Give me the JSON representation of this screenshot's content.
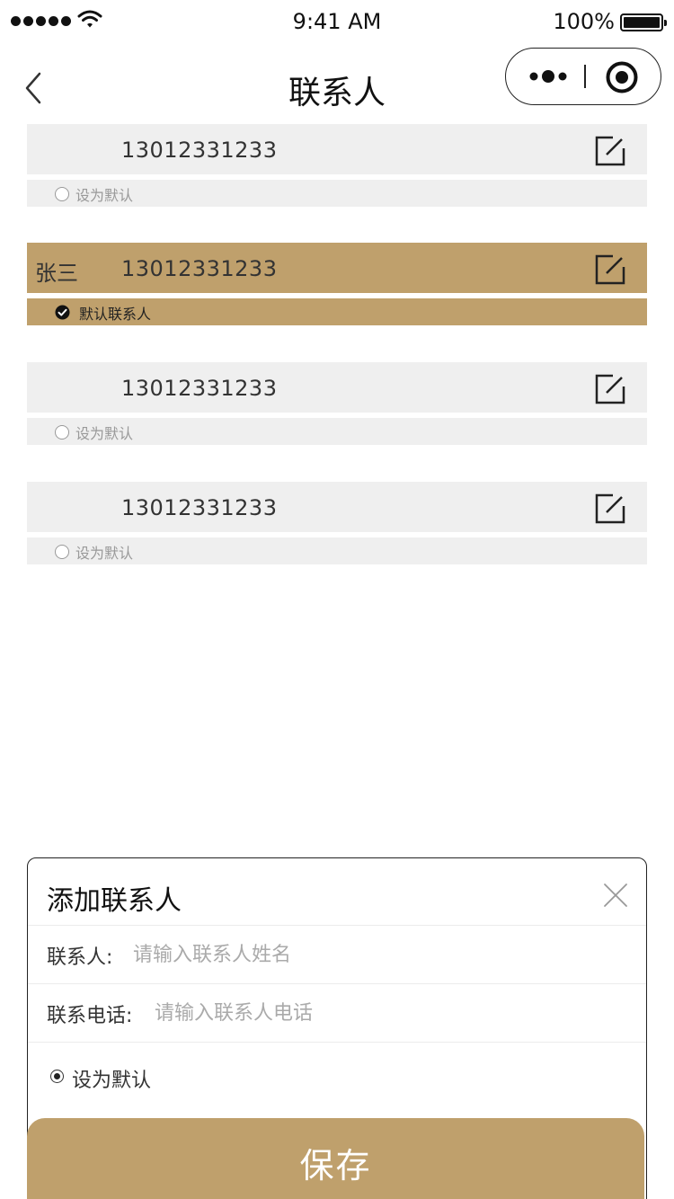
{
  "status_bar": {
    "time": "9:41 AM",
    "battery": "100%"
  },
  "nav": {
    "title": "联系人"
  },
  "contacts": [
    {
      "name": "",
      "phone": "13012331233",
      "default_label": "设为默认",
      "is_default": false
    },
    {
      "name": "张三",
      "phone": "13012331233",
      "default_label": "默认联系人",
      "is_default": true
    },
    {
      "name": "",
      "phone": "13012331233",
      "default_label": "设为默认",
      "is_default": false
    },
    {
      "name": "",
      "phone": "13012331233",
      "default_label": "设为默认",
      "is_default": false
    }
  ],
  "add_panel": {
    "title": "添加联系人",
    "name_label": "联系人:",
    "name_placeholder": "请输入联系人姓名",
    "phone_label": "联系电话:",
    "phone_placeholder": "请输入联系人电话",
    "default_label": "设为默认",
    "save_label": "保存"
  },
  "colors": {
    "accent": "#bfa06c",
    "card_bg": "#efefef"
  }
}
